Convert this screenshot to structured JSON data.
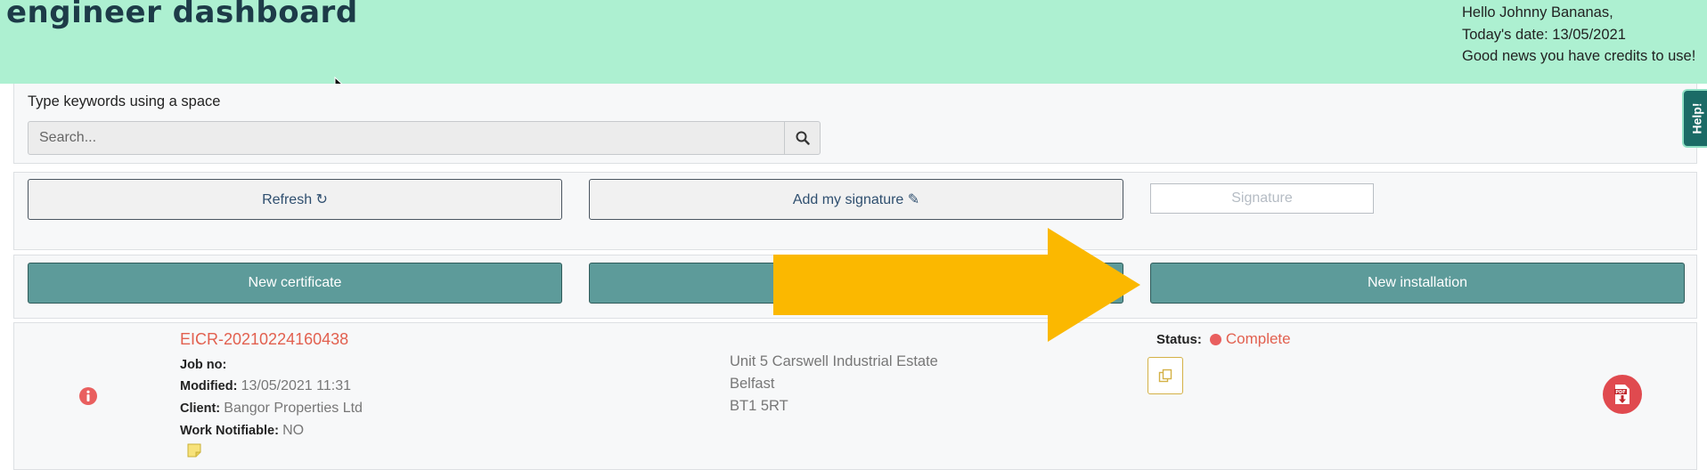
{
  "header": {
    "title": "engineer dashboard",
    "greeting_line1": "Hello Johnny Bananas,",
    "greeting_line2": "Today's date: 13/05/2021",
    "greeting_line3": "Good news you have credits to use!",
    "background_color": "#adf0d1"
  },
  "search": {
    "label": "Type keywords using a space",
    "placeholder": "Search...",
    "value": "",
    "icon": "search-icon"
  },
  "help": {
    "label": "Help!"
  },
  "actions": {
    "refresh_label": "Refresh ↻",
    "add_signature_label": "Add my signature ✎",
    "signature_label": "Signature"
  },
  "new_buttons": {
    "new_certificate_label": "New certificate",
    "new_installation_label": "New installation",
    "button_color": "#5d9b9a"
  },
  "arrow": {
    "color": "#fbb800",
    "icon": "arrow-right-icon"
  },
  "job": {
    "id": "EICR-20210224160438",
    "job_no_label": "Job no:",
    "job_no": "",
    "modified_label": "Modified:",
    "modified": "13/05/2021 11:31",
    "client_label": "Client:",
    "client": "Bangor Properties Ltd",
    "work_notifiable_label": "Work Notifiable:",
    "work_notifiable": "NO",
    "address_line1": "Unit 5 Carswell Industrial Estate",
    "address_line2": "Belfast",
    "address_line3": "BT1 5RT",
    "status_label": "Status:",
    "status": "Complete",
    "status_color": "#e95f5f",
    "info_icon": "info-icon",
    "note_icon": "sticky-note-icon",
    "copy_icon": "copy-icon",
    "pdf_icon": "pdf-download-icon"
  }
}
